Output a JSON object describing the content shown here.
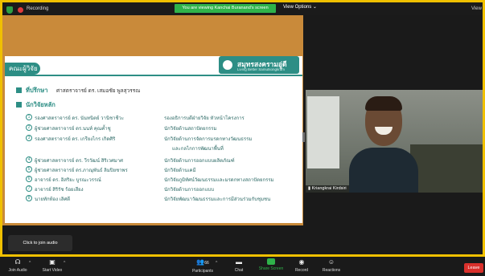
{
  "topbar": {
    "recording_label": "Recording",
    "viewing_banner": "You are viewing Kanchai Buranand's screen",
    "view_options": "View Options ⌄",
    "view_label": "View"
  },
  "slide": {
    "header": "คณะผู้วิจัย",
    "logo_title": "สมุทรสงครามอู่ดี",
    "logo_sub": "Living Better Samutsongkram",
    "advisor_title": "ที่ปรึกษา",
    "advisor_name": "ศาสตราจารย์ ดร. เสมอชัย พูลสุวรรณ",
    "researchers_title": "นักวิจัยหลัก",
    "rows": [
      {
        "num": "1",
        "name": "รองศาสตราจารย์ ดร. นันทนิตย์ วานิชาชีวะ",
        "role": "รองอธิการบดีฝ่ายวิจัย หัวหน้าโครงการ"
      },
      {
        "num": "2",
        "name": "ผู้ช่วยศาสตราจารย์ ดร.นนท์ คุณค้ำชู",
        "role": "นักวิจัยด้านสถาปัตยกรรม"
      },
      {
        "num": "3",
        "name": "รองศาสตราจารย์ ดร. เกรียงไกร เกิดศิริ",
        "role": "นักวิจัยด้านการจัดการมรดกทางวัฒนธรรม"
      },
      {
        "num": "",
        "name": "",
        "role": "และกลไกการพัฒนาพื้นที่"
      },
      {
        "num": "4",
        "name": "ผู้ช่วยศาสตราจารย์ ดร. วีรวัฒน์ สิริเวศมาศ",
        "role": "นักวิจัยด้านการออกแบบผลิตภัณฑ์"
      },
      {
        "num": "5",
        "name": "ผู้ช่วยศาสตราจารย์ ดร.ภาณุพันธ์ ลิมปิยชาพร",
        "role": "นักวิจัยด้านเคมี"
      },
      {
        "num": "6",
        "name": "อาจารย์ ดร. อิสริยะ บูรณะวรรณ์",
        "role": "นักวิจัยภูมิทัศน์วัฒนธรรมและมรดกทางสถาปัตยกรรม"
      },
      {
        "num": "7",
        "name": "อาจารย์ สิริรัช ร้อยเสียง",
        "role": "นักวิจัยด้านการออกแบบ"
      },
      {
        "num": "8",
        "name": "นายทักท้อง เลิศดี",
        "role": "นักวิจัยพัฒนาวัฒนธรรมและการมีส่วนร่วมกับชุมชน"
      }
    ]
  },
  "video": {
    "participant_name": "Kriangkrai Kirdsiri"
  },
  "audio_tip": "Click to join audio",
  "toolbar": {
    "join_audio": "Join Audio",
    "start_video": "Start Video",
    "participants": "Participants",
    "participants_count": "66",
    "chat": "Chat",
    "share_screen": "Share Screen",
    "record": "Record",
    "reactions": "Reactions",
    "leave": "Leave"
  },
  "colors": {
    "accent": "#2d8e85",
    "share_green": "#2fb34a",
    "leave_red": "#d9302b",
    "frame_yellow": "#f0c000"
  }
}
